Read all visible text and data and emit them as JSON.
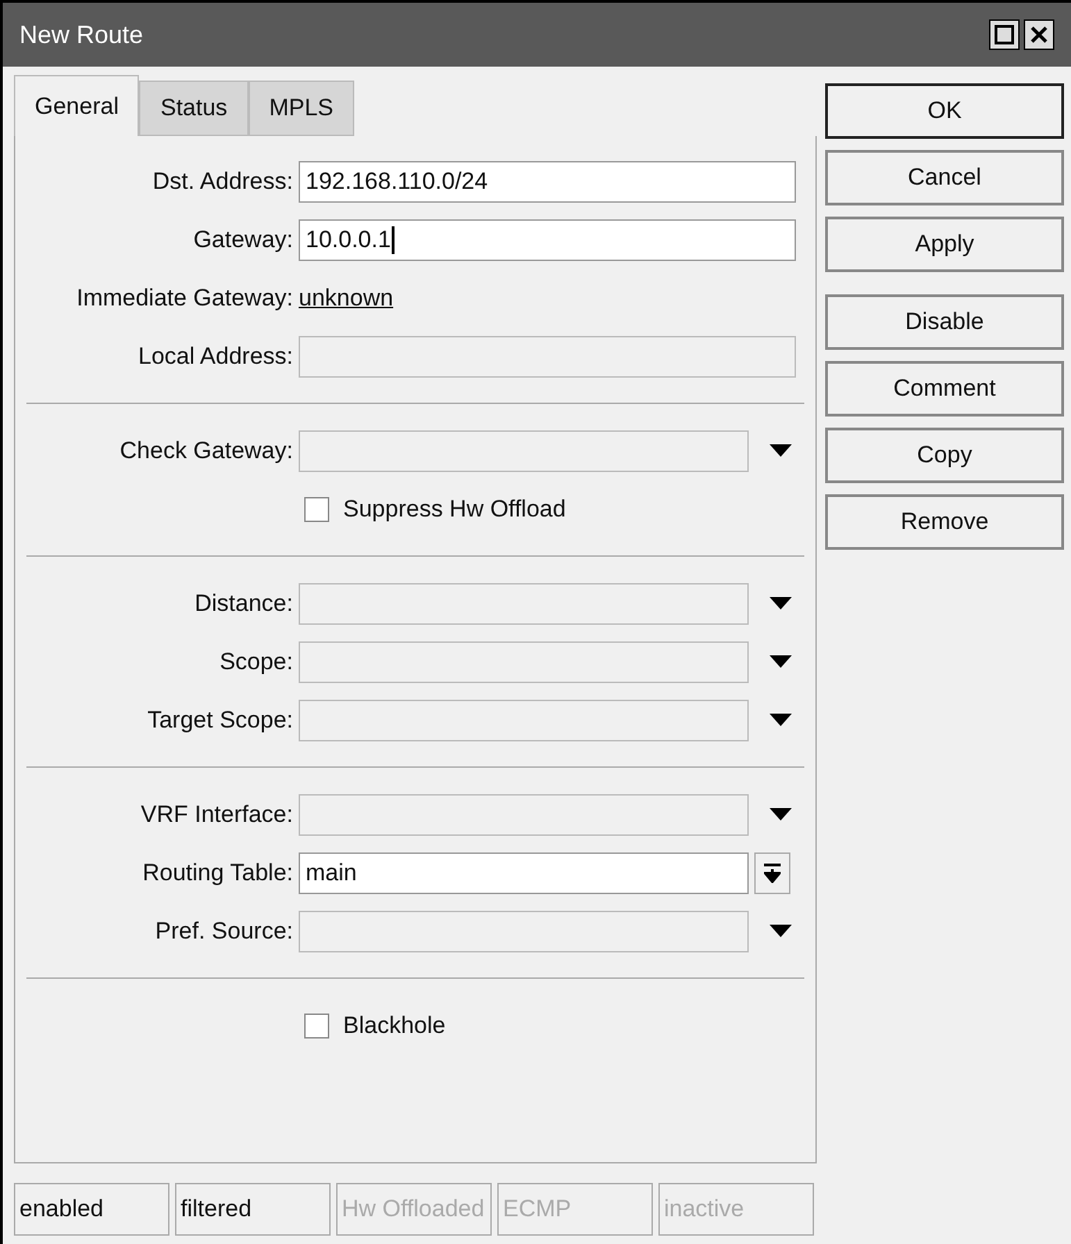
{
  "window": {
    "title": "New Route"
  },
  "tabs": [
    {
      "label": "General",
      "selected": true
    },
    {
      "label": "Status",
      "selected": false
    },
    {
      "label": "MPLS",
      "selected": false
    }
  ],
  "sections": [
    [
      {
        "kind": "text",
        "label": "Dst. Address:",
        "value": "192.168.110.0/24",
        "focused": false
      },
      {
        "kind": "text",
        "label": "Gateway:",
        "value": "10.0.0.1",
        "focused": true
      },
      {
        "kind": "link",
        "label": "Immediate Gateway:",
        "value": "unknown"
      },
      {
        "kind": "readonly",
        "label": "Local Address:"
      }
    ],
    [
      {
        "kind": "dropdown",
        "label": "Check Gateway:"
      },
      {
        "kind": "checkbox",
        "label": "Suppress Hw Offload",
        "checked": false
      }
    ],
    [
      {
        "kind": "dropdown",
        "label": "Distance:"
      },
      {
        "kind": "dropdown",
        "label": "Scope:"
      },
      {
        "kind": "dropdown",
        "label": "Target Scope:"
      }
    ],
    [
      {
        "kind": "dropdown",
        "label": "VRF Interface:"
      },
      {
        "kind": "combo",
        "label": "Routing Table:",
        "value": "main"
      },
      {
        "kind": "dropdown",
        "label": "Pref. Source:"
      }
    ],
    [
      {
        "kind": "checkbox",
        "label": "Blackhole",
        "checked": false
      }
    ]
  ],
  "button_groups": [
    [
      "OK",
      "Cancel",
      "Apply"
    ],
    [
      "Disable",
      "Comment",
      "Copy",
      "Remove"
    ]
  ],
  "status_bar": [
    {
      "text": "enabled",
      "disabled": false
    },
    {
      "text": "filtered",
      "disabled": false
    },
    {
      "text": "Hw Offloaded",
      "disabled": true
    },
    {
      "text": "ECMP",
      "disabled": true
    },
    {
      "text": "inactive",
      "disabled": true
    }
  ]
}
